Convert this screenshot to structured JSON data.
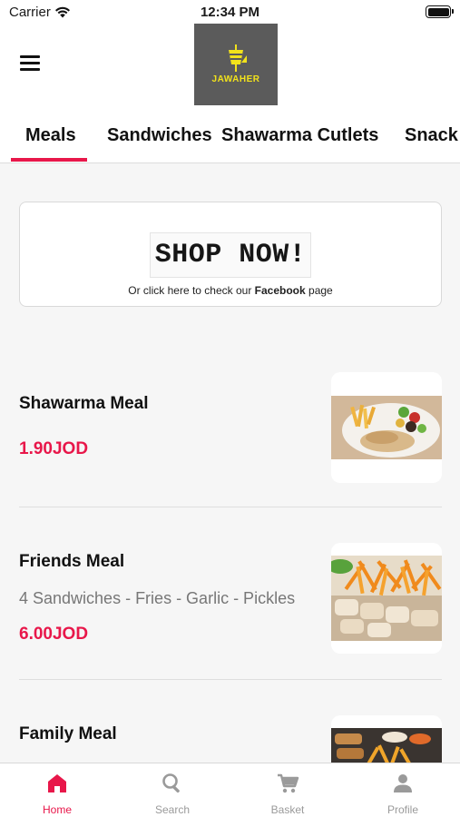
{
  "status_bar": {
    "carrier": "Carrier",
    "time": "12:34 PM"
  },
  "header": {
    "logo_text": "JAWAHER"
  },
  "tabs": [
    {
      "label": "Meals",
      "active": true
    },
    {
      "label": "Sandwiches",
      "active": false
    },
    {
      "label": "Shawarma Cutlets",
      "active": false
    },
    {
      "label": "Snack",
      "active": false
    }
  ],
  "banner": {
    "headline": "SHOP NOW!",
    "sub_before": "Or click here to check our",
    "sub_bold": "Facebook",
    "sub_after": "page"
  },
  "items": [
    {
      "name": "Shawarma Meal",
      "description": "",
      "price": "1.90JOD"
    },
    {
      "name": "Friends Meal",
      "description": "4 Sandwiches - Fries - Garlic - Pickles",
      "price": "6.00JOD"
    },
    {
      "name": "Family Meal",
      "description": "",
      "price": ""
    }
  ],
  "bottom_nav": [
    {
      "label": "Home",
      "icon": "home-icon",
      "active": true
    },
    {
      "label": "Search",
      "icon": "search-icon",
      "active": false
    },
    {
      "label": "Basket",
      "icon": "cart-icon",
      "active": false
    },
    {
      "label": "Profile",
      "icon": "person-icon",
      "active": false
    }
  ],
  "colors": {
    "accent": "#e8174a",
    "logo_bg": "#5b5b5b",
    "logo_text": "#f2e21b",
    "inactive": "#9a9a9a"
  }
}
